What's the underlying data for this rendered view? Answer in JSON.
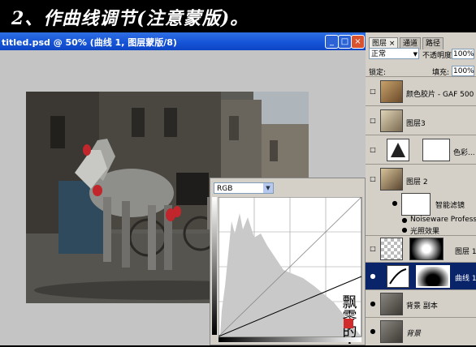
{
  "banner": {
    "title": "2、作曲线调节(注意蒙版)。"
  },
  "document": {
    "title": "titled.psd @ 50% (曲线 1, 图层蒙版/8)",
    "min_icon": "minimize-icon",
    "max_icon": "maximize-icon",
    "close_icon": "close-icon"
  },
  "curves": {
    "channel": "RGB",
    "calligraphy": "飘零的人"
  },
  "layers_panel": {
    "tabs": [
      "图层",
      "通道",
      "路径"
    ],
    "blend_mode": "正常",
    "opacity_label": "不透明度:",
    "opacity_value": "100%",
    "lock_label": "锁定:",
    "fill_label": "填充:",
    "fill_value": "100%",
    "layers": [
      {
        "name": "颜色胶片 - GAF 500 ...",
        "visible": false
      },
      {
        "name": "图层3",
        "visible": false
      },
      {
        "name": "色彩...",
        "visible": false
      },
      {
        "name": "图层 2",
        "visible": false
      },
      {
        "name": "智能滤镜",
        "visible": true
      },
      {
        "name": "Noiseware Professional",
        "visible": true
      },
      {
        "name": "光照效果",
        "visible": true
      },
      {
        "name": "图层 1",
        "visible": false
      },
      {
        "name": "曲线 1",
        "visible": true,
        "selected": true
      },
      {
        "name": "背景 副本",
        "visible": true
      },
      {
        "name": "背景",
        "visible": true
      }
    ]
  },
  "colors": {
    "titlebar": "#1452d6",
    "selected_row": "#0a246a",
    "panel_bg": "#d4d0c8"
  }
}
